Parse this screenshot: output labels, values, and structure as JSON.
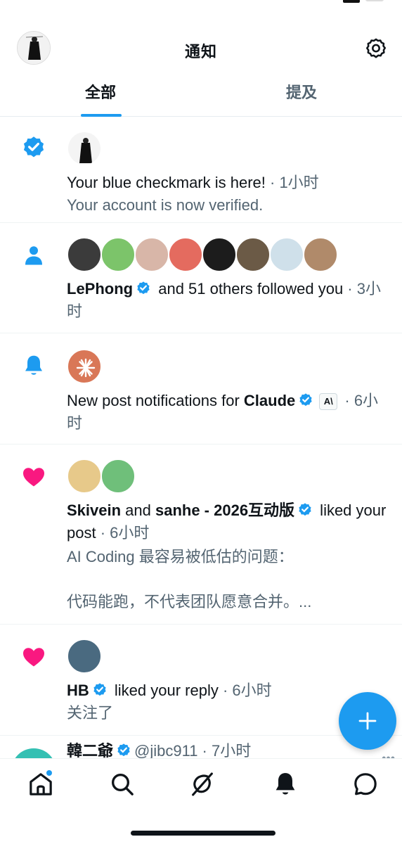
{
  "header": {
    "title": "通知",
    "avatar_icon": "profile-avatar",
    "settings_icon": "gear-icon"
  },
  "tabs": [
    {
      "label": "全部",
      "active": true
    },
    {
      "label": "提及",
      "active": false
    }
  ],
  "notifications": {
    "verified": {
      "icon": "verified-badge-icon",
      "line1": "Your blue checkmark is here!",
      "time": " · 1小时",
      "line2": "Your account is now verified."
    },
    "follow": {
      "icon": "person-icon",
      "name": "LePhong",
      "text": " and 51 others followed you",
      "time": " · 3小时"
    },
    "post_alert": {
      "icon": "bell-icon",
      "text": "New post notifications for ",
      "name": "Claude",
      "badge": "A\\",
      "time": " · 6小时"
    },
    "like_post": {
      "icon": "heart-icon",
      "name1": "Skivein",
      "and": " and ",
      "name2": "sanhe - 2026互动版",
      "text": " liked your post",
      "time": " · 6小时",
      "preview1": "AI Coding 最容易被低估的问题：",
      "preview2": "代码能跑，不代表团队愿意合并。..."
    },
    "like_reply": {
      "icon": "heart-icon",
      "name": "HB",
      "text": " liked your reply",
      "time": " · 6小时",
      "preview": "关注了"
    },
    "partial": {
      "name": "韓二爺",
      "handle": "@jibc911",
      "time": " · 7小时"
    }
  },
  "fab": {
    "label": "+"
  },
  "nav": [
    "home-icon",
    "search-icon",
    "grok-icon",
    "bell-icon",
    "messages-icon"
  ],
  "colors": {
    "accent": "#1d9bf0",
    "like": "#f91880",
    "text": "#0f1419",
    "secondary": "#536471"
  }
}
